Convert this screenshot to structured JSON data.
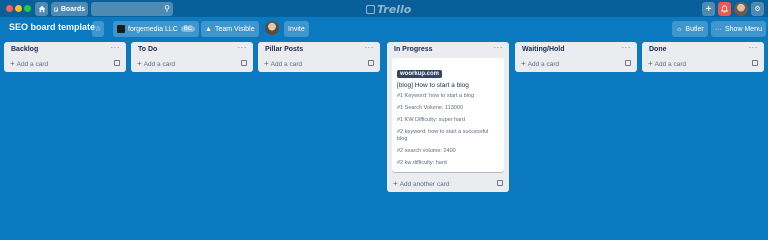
{
  "topbar": {
    "boards_label": "Boards",
    "logo_text": "Trello"
  },
  "board": {
    "title": "SEO board template",
    "team_name": "forgemedia LLC",
    "team_tag": "BC",
    "visibility_label": "Team Visible",
    "invite_label": "Invite",
    "butler_label": "Butler",
    "show_menu_label": "Show Menu"
  },
  "lists": [
    {
      "title": "Backlog",
      "add_label": "Add a card"
    },
    {
      "title": "To Do",
      "add_label": "Add a card"
    },
    {
      "title": "Pillar Posts",
      "add_label": "Add a card"
    },
    {
      "title": "In Progress",
      "add_label": "Add another card"
    },
    {
      "title": "Waiting/Hold",
      "add_label": "Add a card"
    },
    {
      "title": "Done",
      "add_label": "Add a card"
    }
  ],
  "card": {
    "badge": "woorkup.com",
    "title": "[blog] How to start a blog",
    "lines": [
      "#1 Keyword: how to start a blog",
      "#1 Search Volume: 113000",
      "#1 KW Difficulty: super hard",
      "#2 keyword: how to start a successful blog",
      "#2 search volume: 2400",
      "#2 kw difficulty: hard"
    ]
  },
  "colors": {
    "board_background": "#0a79bf",
    "topbar": "#095f99",
    "list_background": "#ebecf0",
    "notification": "#eb5a46"
  }
}
